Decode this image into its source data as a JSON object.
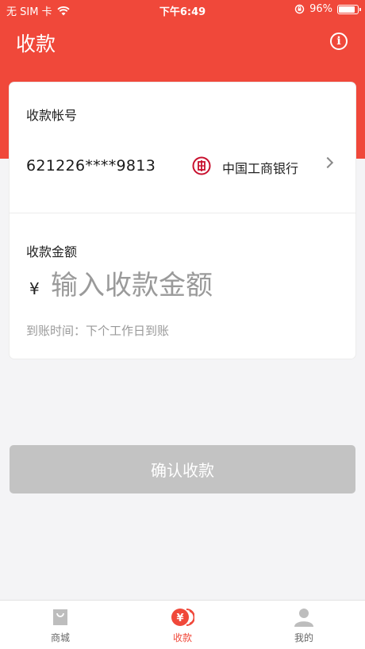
{
  "status_bar": {
    "carrier": "无 SIM 卡",
    "time": "下午6:49",
    "battery": "96%",
    "battery_level": 0.96
  },
  "header": {
    "title": "收款",
    "info_icon": "info-icon"
  },
  "colors": {
    "brand_red": "#f0483a",
    "disabled_button": "#c3c3c3"
  },
  "account": {
    "label": "收款帐号",
    "number": "621226****9813",
    "bank_name": "中国工商银行",
    "bank_icon": "icbc-logo-icon"
  },
  "amount": {
    "label": "收款金额",
    "currency": "¥",
    "placeholder": "输入收款金额",
    "value": ""
  },
  "arrival_time": "到账时间：下个工作日到账",
  "confirm_button": "确认收款",
  "tabs": [
    {
      "label": "商城",
      "icon": "shopping-bag-icon",
      "active": false
    },
    {
      "label": "收款",
      "icon": "yen-coin-icon",
      "active": true
    },
    {
      "label": "我的",
      "icon": "person-icon",
      "active": false
    }
  ]
}
